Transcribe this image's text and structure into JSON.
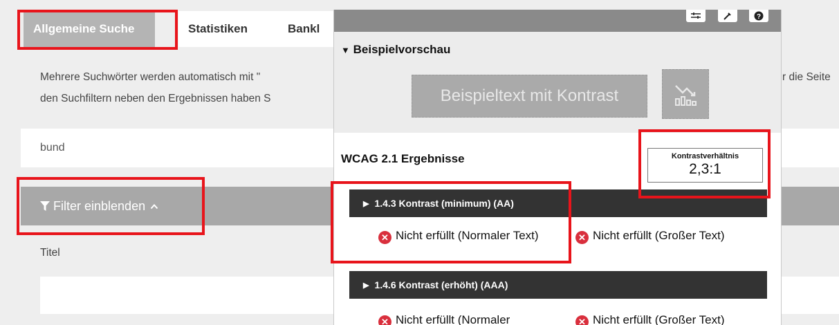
{
  "tabs": {
    "active": "Allgemeine Suche",
    "statistics": "Statistiken",
    "bank": "Bankl"
  },
  "info": {
    "line1": "Mehrere Suchwörter werden automatisch mit \"",
    "line2": "den Suchfiltern neben den Ergebnissen haben S",
    "right1": "r die Seite"
  },
  "search": {
    "value": "bund"
  },
  "filter": {
    "label": "Filter einblenden"
  },
  "form": {
    "title_label": "Titel"
  },
  "panel": {
    "preview_heading": "Beispielvorschau",
    "sample_text": "Beispieltext mit Kontrast",
    "results_heading": "WCAG 2.1 Ergebnisse",
    "ratio_label": "Kontrastverhältnis",
    "ratio_value": "2,3:1",
    "criteria": [
      {
        "label": "1.4.3 Kontrast (minimum) (AA)",
        "normal": "Nicht erfüllt (Normaler Text)",
        "large": "Nicht erfüllt (Großer Text)"
      },
      {
        "label": "1.4.6 Kontrast (erhöht) (AAA)",
        "normal": "Nicht erfüllt (Normaler",
        "large": "Nicht erfüllt (Großer Text)"
      }
    ]
  },
  "colors": {
    "highlight": "#e8141b",
    "fail": "#d92f3d",
    "dark_bar": "#333333"
  }
}
